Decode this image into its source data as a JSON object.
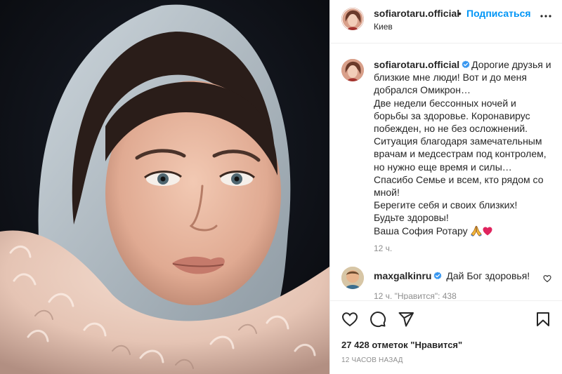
{
  "post": {
    "username": "sofiarotaru.official",
    "location": "Киев",
    "follow_label": "Подписаться",
    "dot": "•"
  },
  "caption": {
    "username": "sofiarotaru.official",
    "lines": [
      "Дорогие друзья и",
      "близкие мне люди! Вот и до меня",
      "добрался Омикрон…",
      "Две недели бессонных ночей и",
      "борьбы за здоровье. Коронавирус",
      "побежден, но не без осложнений.",
      "Ситуация благодаря замечательным",
      "врачам и медсестрам под контролем,",
      "но нужно еще время и силы…",
      "Спасибо Семье и всем, кто рядом со",
      "мной!",
      "Берегите себя и своих близких!",
      "Будьте здоровы!",
      "Ваша София Ротару"
    ],
    "time": "12 ч."
  },
  "comment": {
    "username": "maxgalkinru",
    "text": "Дай Бог здоровья!",
    "meta": "12 ч.    \"Нравится\": 438"
  },
  "footer": {
    "likes": "27 428 отметок \"Нравится\"",
    "time": "12 ЧАСОВ НАЗАД"
  },
  "icons": {
    "like": "heart-icon",
    "comment": "comment-icon",
    "share": "share-icon",
    "save": "bookmark-icon",
    "more": "more-icon",
    "verified": "verified-icon"
  },
  "colors": {
    "accent": "#0095f6",
    "verified": "#3897f0",
    "secondary_text": "#8e8e8e",
    "heart_emoji": "#e0245e"
  }
}
